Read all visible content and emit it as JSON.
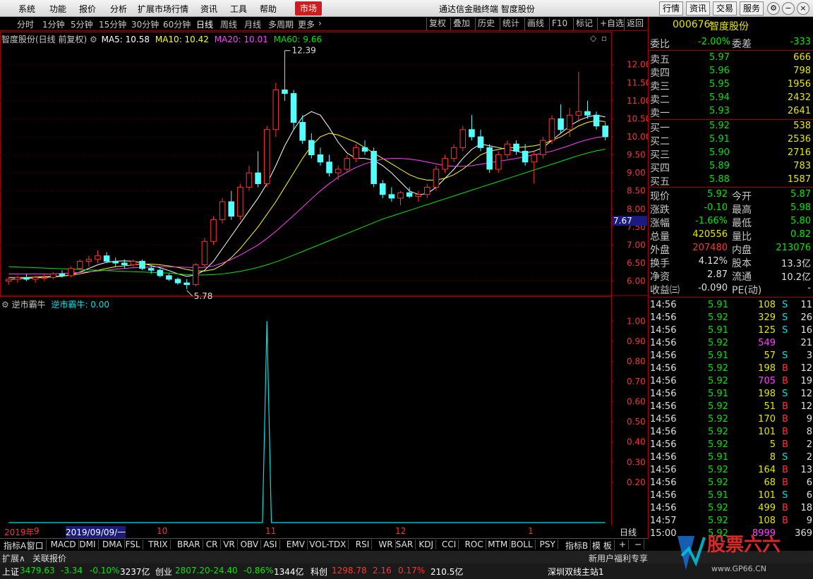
{
  "menu": {
    "items": [
      "系统",
      "功能",
      "报价",
      "分析",
      "扩展市场行情",
      "资讯",
      "工具",
      "帮助"
    ],
    "market": "市场",
    "title": "通达信金融终端  智度股份",
    "right_buttons": [
      "行情",
      "资讯",
      "交易",
      "服务"
    ]
  },
  "periods": {
    "items": [
      "分时",
      "1分钟",
      "5分钟",
      "15分钟",
      "30分钟",
      "60分钟",
      "日线",
      "周线",
      "月线",
      "多周期",
      "更多"
    ],
    "tools": [
      "复权",
      "叠加",
      "历史",
      "统计",
      "画线",
      "F10",
      "标记",
      "+自选",
      "返回"
    ]
  },
  "price_chart": {
    "header": "智度股份(日线 前复权)",
    "ma": [
      {
        "label": "MA5: 10.58",
        "color": "#ffffff"
      },
      {
        "label": "MA10: 10.42",
        "color": "#ffff00"
      },
      {
        "label": "MA20: 10.01",
        "color": "#ff40ff"
      },
      {
        "label": "MA60: 9.66",
        "color": "#00e600"
      }
    ],
    "yticks": [
      "12.00",
      "11.50",
      "11.00",
      "10.50",
      "10.00",
      "9.50",
      "9.00",
      "8.50",
      "8.00",
      "7.50",
      "7.00",
      "6.50",
      "6.00"
    ],
    "high_label": "12.39",
    "low_label": "5.78",
    "current": "7.67"
  },
  "indicator": {
    "name": "逆市霸牛",
    "value_label": "逆市霸牛: 0.00",
    "yticks": [
      "1.00",
      "0.90",
      "0.80",
      "0.70",
      "0.60",
      "0.50",
      "0.40",
      "0.30",
      "0.20"
    ],
    "line_color": "#00e0e0"
  },
  "chart_data": {
    "type": "candlestick",
    "ylim": [
      5.6,
      12.6
    ],
    "ohlc": [
      [
        6.0,
        6.1,
        5.9,
        6.05
      ],
      [
        6.05,
        6.15,
        5.95,
        6.1
      ],
      [
        6.1,
        6.2,
        6.0,
        6.05
      ],
      [
        6.05,
        6.15,
        5.95,
        6.1
      ],
      [
        6.1,
        6.2,
        6.0,
        6.1
      ],
      [
        6.1,
        6.25,
        6.05,
        6.2
      ],
      [
        6.2,
        6.3,
        6.1,
        6.15
      ],
      [
        6.15,
        6.4,
        6.1,
        6.35
      ],
      [
        6.35,
        6.6,
        6.3,
        6.55
      ],
      [
        6.55,
        6.7,
        6.4,
        6.6
      ],
      [
        6.6,
        6.85,
        6.5,
        6.7
      ],
      [
        6.7,
        6.8,
        6.5,
        6.55
      ],
      [
        6.55,
        6.65,
        6.4,
        6.5
      ],
      [
        6.5,
        6.6,
        6.35,
        6.45
      ],
      [
        6.45,
        6.6,
        6.4,
        6.55
      ],
      [
        6.55,
        6.6,
        6.3,
        6.35
      ],
      [
        6.35,
        6.45,
        6.2,
        6.3
      ],
      [
        6.3,
        6.35,
        6.1,
        6.15
      ],
      [
        6.15,
        6.2,
        6.0,
        6.05
      ],
      [
        6.05,
        6.1,
        5.9,
        5.95
      ],
      [
        5.95,
        6.05,
        5.78,
        5.9
      ],
      [
        5.9,
        6.5,
        5.85,
        6.45
      ],
      [
        6.45,
        7.2,
        6.4,
        7.1
      ],
      [
        7.1,
        7.8,
        7.0,
        7.7
      ],
      [
        7.7,
        8.3,
        7.6,
        8.2
      ],
      [
        8.2,
        8.5,
        7.7,
        7.8
      ],
      [
        7.8,
        8.7,
        7.7,
        8.6
      ],
      [
        8.6,
        9.2,
        8.5,
        9.0
      ],
      [
        9.0,
        9.6,
        8.6,
        8.7
      ],
      [
        8.7,
        10.3,
        8.6,
        10.2
      ],
      [
        10.2,
        11.5,
        10.0,
        11.3
      ],
      [
        11.3,
        12.39,
        11.0,
        11.2
      ],
      [
        11.2,
        11.3,
        10.2,
        10.4
      ],
      [
        10.4,
        10.6,
        9.8,
        9.9
      ],
      [
        9.9,
        10.1,
        9.4,
        9.5
      ],
      [
        9.5,
        9.7,
        9.2,
        9.3
      ],
      [
        9.3,
        9.5,
        8.9,
        9.0
      ],
      [
        9.0,
        9.2,
        8.8,
        9.1
      ],
      [
        9.1,
        9.5,
        9.0,
        9.4
      ],
      [
        9.4,
        9.8,
        9.3,
        9.7
      ],
      [
        9.7,
        9.9,
        9.5,
        9.6
      ],
      [
        9.6,
        9.7,
        8.6,
        8.7
      ],
      [
        8.7,
        8.8,
        8.3,
        8.4
      ],
      [
        8.4,
        8.6,
        8.2,
        8.3
      ],
      [
        8.3,
        8.5,
        8.1,
        8.45
      ],
      [
        8.45,
        8.6,
        8.3,
        8.35
      ],
      [
        8.35,
        8.5,
        8.2,
        8.4
      ],
      [
        8.4,
        8.7,
        8.3,
        8.6
      ],
      [
        8.6,
        9.2,
        8.5,
        9.1
      ],
      [
        9.1,
        9.5,
        9.0,
        9.4
      ],
      [
        9.4,
        9.8,
        9.3,
        9.7
      ],
      [
        9.7,
        10.3,
        9.6,
        10.2
      ],
      [
        10.2,
        10.6,
        9.9,
        10.0
      ],
      [
        10.0,
        10.2,
        9.6,
        9.7
      ],
      [
        9.7,
        9.8,
        9.0,
        9.1
      ],
      [
        9.1,
        9.6,
        9.0,
        9.5
      ],
      [
        9.5,
        9.9,
        9.4,
        9.8
      ],
      [
        9.8,
        9.9,
        9.5,
        9.6
      ],
      [
        9.6,
        9.8,
        9.2,
        9.3
      ],
      [
        9.3,
        9.6,
        8.7,
        9.5
      ],
      [
        9.5,
        10.0,
        9.4,
        9.9
      ],
      [
        9.9,
        10.6,
        9.8,
        10.5
      ],
      [
        10.5,
        10.9,
        10.1,
        10.2
      ],
      [
        10.2,
        10.8,
        10.0,
        10.6
      ],
      [
        10.6,
        11.8,
        10.4,
        10.7
      ],
      [
        10.7,
        11.0,
        10.5,
        10.6
      ],
      [
        10.6,
        10.7,
        10.2,
        10.3
      ],
      [
        10.3,
        10.4,
        9.9,
        10.0
      ]
    ],
    "ma5": [
      6.05,
      6.06,
      6.08,
      6.09,
      6.1,
      6.12,
      6.13,
      6.18,
      6.25,
      6.35,
      6.45,
      6.52,
      6.55,
      6.56,
      6.55,
      6.5,
      6.43,
      6.37,
      6.29,
      6.2,
      6.13,
      6.17,
      6.3,
      6.55,
      6.9,
      7.25,
      7.6,
      7.95,
      8.3,
      8.7,
      9.2,
      9.75,
      10.2,
      10.55,
      10.7,
      10.6,
      10.25,
      9.85,
      9.55,
      9.4,
      9.4,
      9.35,
      9.2,
      9.0,
      8.75,
      8.5,
      8.4,
      8.42,
      8.6,
      8.85,
      9.1,
      9.4,
      9.65,
      9.8,
      9.75,
      9.7,
      9.65,
      9.6,
      9.55,
      9.6,
      9.7,
      9.9,
      10.1,
      10.3,
      10.45,
      10.55,
      10.6,
      10.55
    ],
    "ma10": [
      6.1,
      6.1,
      6.1,
      6.11,
      6.12,
      6.13,
      6.14,
      6.16,
      6.2,
      6.25,
      6.3,
      6.35,
      6.4,
      6.42,
      6.45,
      6.47,
      6.47,
      6.45,
      6.42,
      6.38,
      6.32,
      6.28,
      6.28,
      6.32,
      6.45,
      6.65,
      6.9,
      7.2,
      7.5,
      7.85,
      8.2,
      8.6,
      9.0,
      9.4,
      9.75,
      10.0,
      10.1,
      10.05,
      9.95,
      9.85,
      9.7,
      9.55,
      9.4,
      9.25,
      9.1,
      8.95,
      8.85,
      8.8,
      8.8,
      8.85,
      8.95,
      9.1,
      9.3,
      9.5,
      9.6,
      9.65,
      9.7,
      9.7,
      9.72,
      9.75,
      9.8,
      9.9,
      10.0,
      10.15,
      10.3,
      10.4,
      10.45,
      10.42
    ],
    "ma20": [
      6.2,
      6.2,
      6.2,
      6.2,
      6.2,
      6.2,
      6.21,
      6.22,
      6.24,
      6.26,
      6.28,
      6.3,
      6.33,
      6.35,
      6.37,
      6.38,
      6.39,
      6.4,
      6.4,
      6.39,
      6.38,
      6.37,
      6.38,
      6.42,
      6.5,
      6.6,
      6.72,
      6.86,
      7.0,
      7.18,
      7.38,
      7.6,
      7.82,
      8.05,
      8.28,
      8.5,
      8.7,
      8.88,
      9.02,
      9.15,
      9.25,
      9.32,
      9.38,
      9.4,
      9.4,
      9.38,
      9.35,
      9.3,
      9.25,
      9.2,
      9.18,
      9.18,
      9.2,
      9.24,
      9.28,
      9.32,
      9.36,
      9.4,
      9.45,
      9.5,
      9.55,
      9.6,
      9.68,
      9.76,
      9.85,
      9.92,
      9.98,
      10.01
    ],
    "ma60": [
      6.4,
      6.39,
      6.38,
      6.37,
      6.36,
      6.35,
      6.34,
      6.33,
      6.32,
      6.31,
      6.3,
      6.29,
      6.28,
      6.27,
      6.26,
      6.25,
      6.24,
      6.23,
      6.22,
      6.2,
      6.18,
      6.17,
      6.17,
      6.18,
      6.2,
      6.23,
      6.27,
      6.32,
      6.38,
      6.45,
      6.53,
      6.62,
      6.72,
      6.82,
      6.92,
      7.02,
      7.12,
      7.22,
      7.32,
      7.42,
      7.52,
      7.62,
      7.72,
      7.8,
      7.88,
      7.96,
      8.04,
      8.12,
      8.2,
      8.28,
      8.36,
      8.44,
      8.52,
      8.6,
      8.68,
      8.76,
      8.84,
      8.92,
      9.0,
      9.08,
      9.16,
      9.24,
      9.32,
      9.4,
      9.48,
      9.55,
      9.61,
      9.66
    ],
    "indicator_values": [
      0,
      0,
      0,
      0,
      0,
      0,
      0,
      0,
      0,
      0,
      0,
      0,
      0,
      0,
      0,
      0,
      0,
      0,
      0,
      0,
      0,
      0,
      0,
      0,
      0,
      0,
      0,
      0,
      0,
      1.0,
      0,
      0,
      0,
      0,
      0,
      0,
      0,
      0,
      0,
      0,
      0,
      0,
      0,
      0,
      0,
      0,
      0,
      0,
      0,
      0,
      0,
      0,
      0,
      0,
      0,
      0,
      0,
      0,
      0,
      0,
      0,
      0,
      0,
      0,
      0,
      0,
      0,
      0
    ],
    "indicator_ylim": [
      0,
      1.05
    ]
  },
  "dates": [
    {
      "label": "2019年",
      "x": 6
    },
    {
      "label": "9",
      "x": 48
    },
    {
      "label": "2019/09/09/一",
      "x": 93
    },
    {
      "label": "10",
      "x": 222
    },
    {
      "label": "11",
      "x": 376
    },
    {
      "label": "12",
      "x": 560
    },
    {
      "label": "1",
      "x": 748
    }
  ],
  "quote": {
    "code": "000676",
    "name": "智度股份",
    "webi": {
      "label": "委比",
      "value": "-2.00%",
      "label2": "委差",
      "value2": "-333"
    },
    "asks": [
      {
        "label": "卖五",
        "price": "5.97",
        "vol": "666"
      },
      {
        "label": "卖四",
        "price": "5.96",
        "vol": "798"
      },
      {
        "label": "卖三",
        "price": "5.95",
        "vol": "1956"
      },
      {
        "label": "卖二",
        "price": "5.94",
        "vol": "2432"
      },
      {
        "label": "卖一",
        "price": "5.93",
        "vol": "2641"
      }
    ],
    "bids": [
      {
        "label": "买一",
        "price": "5.92",
        "vol": "538"
      },
      {
        "label": "买二",
        "price": "5.91",
        "vol": "2536"
      },
      {
        "label": "买三",
        "price": "5.90",
        "vol": "2716"
      },
      {
        "label": "买四",
        "price": "5.89",
        "vol": "783"
      },
      {
        "label": "买五",
        "price": "5.88",
        "vol": "1587"
      }
    ],
    "stats": [
      {
        "l1": "现价",
        "v1": "5.92",
        "c1": "g",
        "l2": "今开",
        "v2": "5.87",
        "c2": "g"
      },
      {
        "l1": "涨跌",
        "v1": "-0.10",
        "c1": "g",
        "l2": "最高",
        "v2": "5.98",
        "c2": "g"
      },
      {
        "l1": "涨幅",
        "v1": "-1.66%",
        "c1": "g",
        "l2": "最低",
        "v2": "5.80",
        "c2": "g"
      },
      {
        "l1": "总量",
        "v1": "420556",
        "c1": "y",
        "l2": "量比",
        "v2": "0.82",
        "c2": "g"
      },
      {
        "l1": "外盘",
        "v1": "207480",
        "c1": "r",
        "l2": "内盘",
        "v2": "213076",
        "c2": "g"
      },
      {
        "l1": "换手",
        "v1": "4.12%",
        "c1": "w",
        "l2": "股本",
        "v2": "13.3亿",
        "c2": "w"
      },
      {
        "l1": "净资",
        "v1": "2.87",
        "c1": "w",
        "l2": "流通",
        "v2": "10.2亿",
        "c2": "w"
      },
      {
        "l1": "收益㈢",
        "v1": "-0.090",
        "c1": "w",
        "l2": "PE(动)",
        "v2": "-",
        "c2": "w"
      }
    ],
    "ticks": [
      [
        "14:56",
        "5.91",
        "108",
        "S",
        "11"
      ],
      [
        "14:56",
        "5.92",
        "329",
        "S",
        "26"
      ],
      [
        "14:56",
        "5.91",
        "125",
        "S",
        "16"
      ],
      [
        "14:56",
        "5.92",
        "549",
        "",
        "21"
      ],
      [
        "14:56",
        "5.91",
        "57",
        "S",
        "3"
      ],
      [
        "14:56",
        "5.92",
        "198",
        "B",
        "12"
      ],
      [
        "14:56",
        "5.92",
        "705",
        "B",
        "19"
      ],
      [
        "14:56",
        "5.91",
        "198",
        "S",
        "12"
      ],
      [
        "14:56",
        "5.92",
        "51",
        "B",
        "12"
      ],
      [
        "14:56",
        "5.92",
        "170",
        "B",
        "9"
      ],
      [
        "14:56",
        "5.92",
        "101",
        "B",
        "8"
      ],
      [
        "14:56",
        "5.92",
        "5",
        "B",
        "2"
      ],
      [
        "14:56",
        "5.91",
        "8",
        "S",
        "2"
      ],
      [
        "14:56",
        "5.92",
        "164",
        "B",
        "13"
      ],
      [
        "14:56",
        "5.92",
        "68",
        "B",
        "6"
      ],
      [
        "14:56",
        "5.91",
        "101",
        "S",
        "6"
      ],
      [
        "14:56",
        "5.92",
        "499",
        "B",
        "18"
      ],
      [
        "14:57",
        "5.92",
        "108",
        "B",
        "9"
      ],
      [
        "15:00",
        "5.92",
        "8999",
        "",
        "369"
      ]
    ]
  },
  "indicators": {
    "left": [
      "指标A",
      "窗口",
      "MACD",
      "DMI",
      "DMA",
      "FSL",
      "TRIX",
      "BRAR",
      "CR",
      "VR",
      "OBV",
      "ASI",
      "EMV",
      "VOL-TDX",
      "RSI",
      "WR",
      "SAR",
      "KDJ",
      "CCI",
      "ROC",
      "MTM",
      "BOLL",
      "PSY"
    ],
    "right": [
      "指标B",
      "模 板",
      "+",
      "−"
    ],
    "period_label": "日线"
  },
  "status": {
    "expand": "扩展∧",
    "related": "关联报价",
    "news": "新用户福利专享",
    "server": "深圳双线主站1",
    "indices": [
      {
        "name": "上证",
        "value": "3479.63",
        "chg": "-3.34",
        "pct": "-0.10%",
        "amt": "3237亿"
      },
      {
        "name": "创业",
        "value": "2807.20",
        "chg": "-24.40",
        "pct": "-0.86%",
        "amt": "1344亿"
      },
      {
        "name": "科创",
        "value": "1298.78",
        "chg": "2.16",
        "pct": "0.17%",
        "amt": "210.5亿"
      }
    ]
  },
  "watermark": {
    "text": "股票六六",
    "url": "www.GP66.CN"
  }
}
